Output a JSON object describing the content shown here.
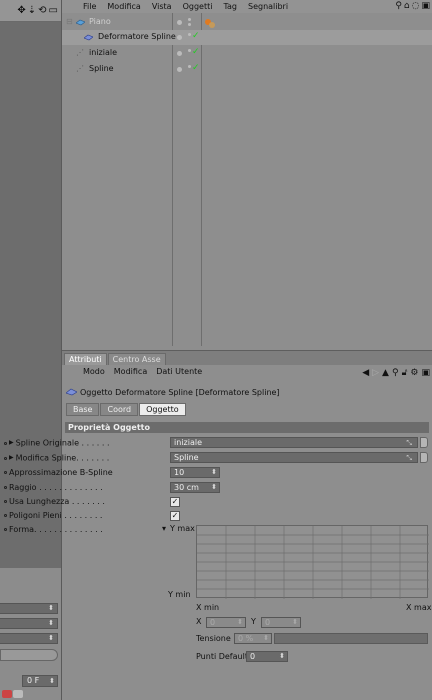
{
  "object_manager": {
    "menu": [
      "File",
      "Modifica",
      "Vista",
      "Oggetti",
      "Tag",
      "Segnalibri"
    ],
    "objects": [
      {
        "name": "Piano",
        "dimmed": true
      },
      {
        "name": "Deformatore Spline",
        "dimmed": false
      },
      {
        "name": "iniziale",
        "dimmed": false
      },
      {
        "name": "Spline",
        "dimmed": false
      }
    ]
  },
  "attributes": {
    "tabs": [
      "Attributi",
      "Centro Asse"
    ],
    "menu": [
      "Modo",
      "Modifica",
      "Dati Utente"
    ],
    "object_title": "Oggetto Deformatore Spline [Deformatore Spline]",
    "subtabs": [
      "Base",
      "Coord",
      "Oggetto"
    ],
    "section": "Proprietà Oggetto",
    "props": {
      "spline_originale": {
        "label": "Spline Originale . . . . . .",
        "value": "iniziale"
      },
      "modifica_spline": {
        "label": "Modifica Spline. . . . . . .",
        "value": "Spline"
      },
      "approssimazione": {
        "label": "Approssimazione B-Spline",
        "value": "10"
      },
      "raggio": {
        "label": "Raggio . . . . . . . . . . . . .",
        "value": "30 cm"
      },
      "usa_lunghezza": {
        "label": "Usa Lunghezza . . . . . . .",
        "check": "✓"
      },
      "poligoni_pieni": {
        "label": "Poligoni Pieni . . . . . . . .",
        "check": "✓"
      },
      "forma": {
        "label": "Forma. . . . . . . . . . . . . ."
      }
    },
    "graph": {
      "y_max": "Y max",
      "y_min": "Y min",
      "x_min": "X min",
      "x_max": "X max",
      "x_label": "X",
      "x_value": "0",
      "y_label": "Y",
      "y_value": "0",
      "tensione_label": "Tensione",
      "tensione_value": "0 %",
      "punti_label": "Punti Default",
      "punti_value": "0"
    }
  },
  "left_panel": {
    "frame_value": "0 F"
  }
}
